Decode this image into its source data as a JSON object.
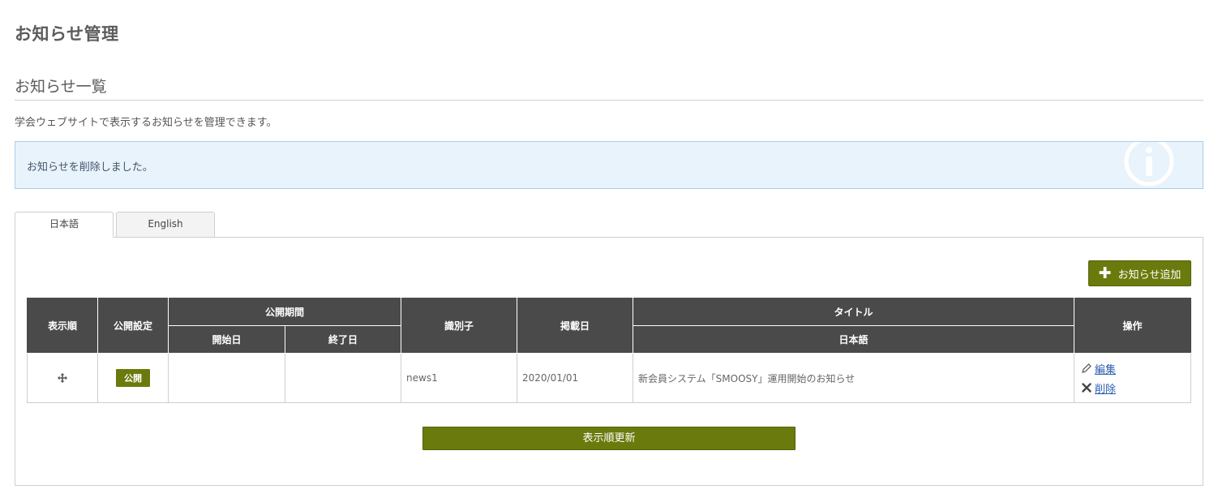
{
  "page": {
    "title": "お知らせ管理",
    "section_title": "お知らせ一覧",
    "description": "学会ウェブサイトで表示するお知らせを管理できます。"
  },
  "alert": {
    "message": "お知らせを削除しました。",
    "icon": "info-icon",
    "color": "#e8f3fb"
  },
  "tabs": [
    {
      "label": "日本語",
      "active": true
    },
    {
      "label": "English",
      "active": false
    }
  ],
  "toolbar": {
    "add_label": "お知らせ追加",
    "add_icon": "plus-icon"
  },
  "table": {
    "headers": {
      "order": "表示順",
      "publish_setting": "公開設定",
      "publish_period": "公開期間",
      "start_date": "開始日",
      "end_date": "終了日",
      "identifier": "識別子",
      "posted_date": "掲載日",
      "title": "タイトル",
      "title_ja": "日本語",
      "operations": "操作"
    },
    "rows": [
      {
        "order_icon": "move-icon",
        "status": "公開",
        "start_date": "",
        "end_date": "",
        "identifier": "news1",
        "posted_date": "2020/01/01",
        "title_ja": "新会員システム「SMOOSY」運用開始のお知らせ",
        "edit_label": "編集",
        "delete_label": "削除"
      }
    ]
  },
  "footer": {
    "update_order_label": "表示順更新"
  },
  "colors": {
    "accent": "#6b7a0c",
    "header_bg": "#4a4a4a",
    "link": "#2a5db0"
  }
}
